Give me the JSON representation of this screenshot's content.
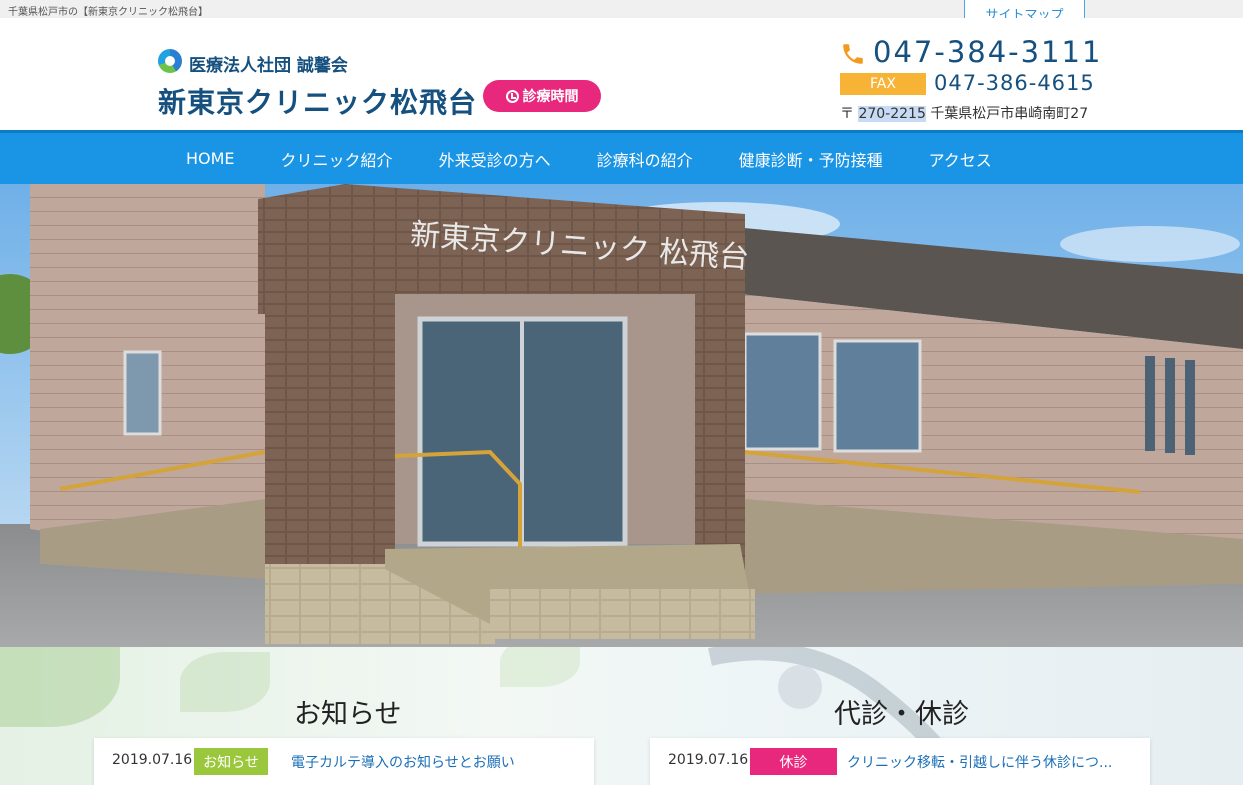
{
  "topbar": {
    "text": "千葉県松戸市の【新東京クリニック松飛台】",
    "sitemap_label": "サイトマップ"
  },
  "header": {
    "corp_name": "医療法人社団 誠馨会",
    "clinic_name": "新東京クリニック松飛台",
    "hours_label": "診療時間",
    "phone": "047-384-3111",
    "fax_label": "FAX",
    "fax_number": "047-386-4615",
    "zip_mark": "〒",
    "zip": "270-2215",
    "address": "千葉県松戸市串崎南町27"
  },
  "nav": [
    {
      "label": "HOME"
    },
    {
      "label": "クリニック紹介"
    },
    {
      "label": "外来受診の方へ"
    },
    {
      "label": "診療科の紹介"
    },
    {
      "label": "健康診断・予防接種"
    },
    {
      "label": "アクセス"
    }
  ],
  "hero": {
    "building_sign": "新東京クリニック 松飛台"
  },
  "news": {
    "title": "お知らせ",
    "items": [
      {
        "date": "2019.07.16",
        "badge": "お知らせ",
        "title": "電子カルテ導入のお知らせとお願い"
      }
    ]
  },
  "closures": {
    "title": "代診・休診",
    "items": [
      {
        "date": "2019.07.16",
        "badge": "休診",
        "title": "クリニック移転・引越しに伴う休診につ..."
      }
    ]
  },
  "colors": {
    "nav_bg": "#1a95e6",
    "brand_navy": "#15507f",
    "accent_pink": "#e8287c",
    "fax_orange": "#f7b336",
    "news_badge": "#9bc73c",
    "closure_badge": "#e8287c"
  }
}
